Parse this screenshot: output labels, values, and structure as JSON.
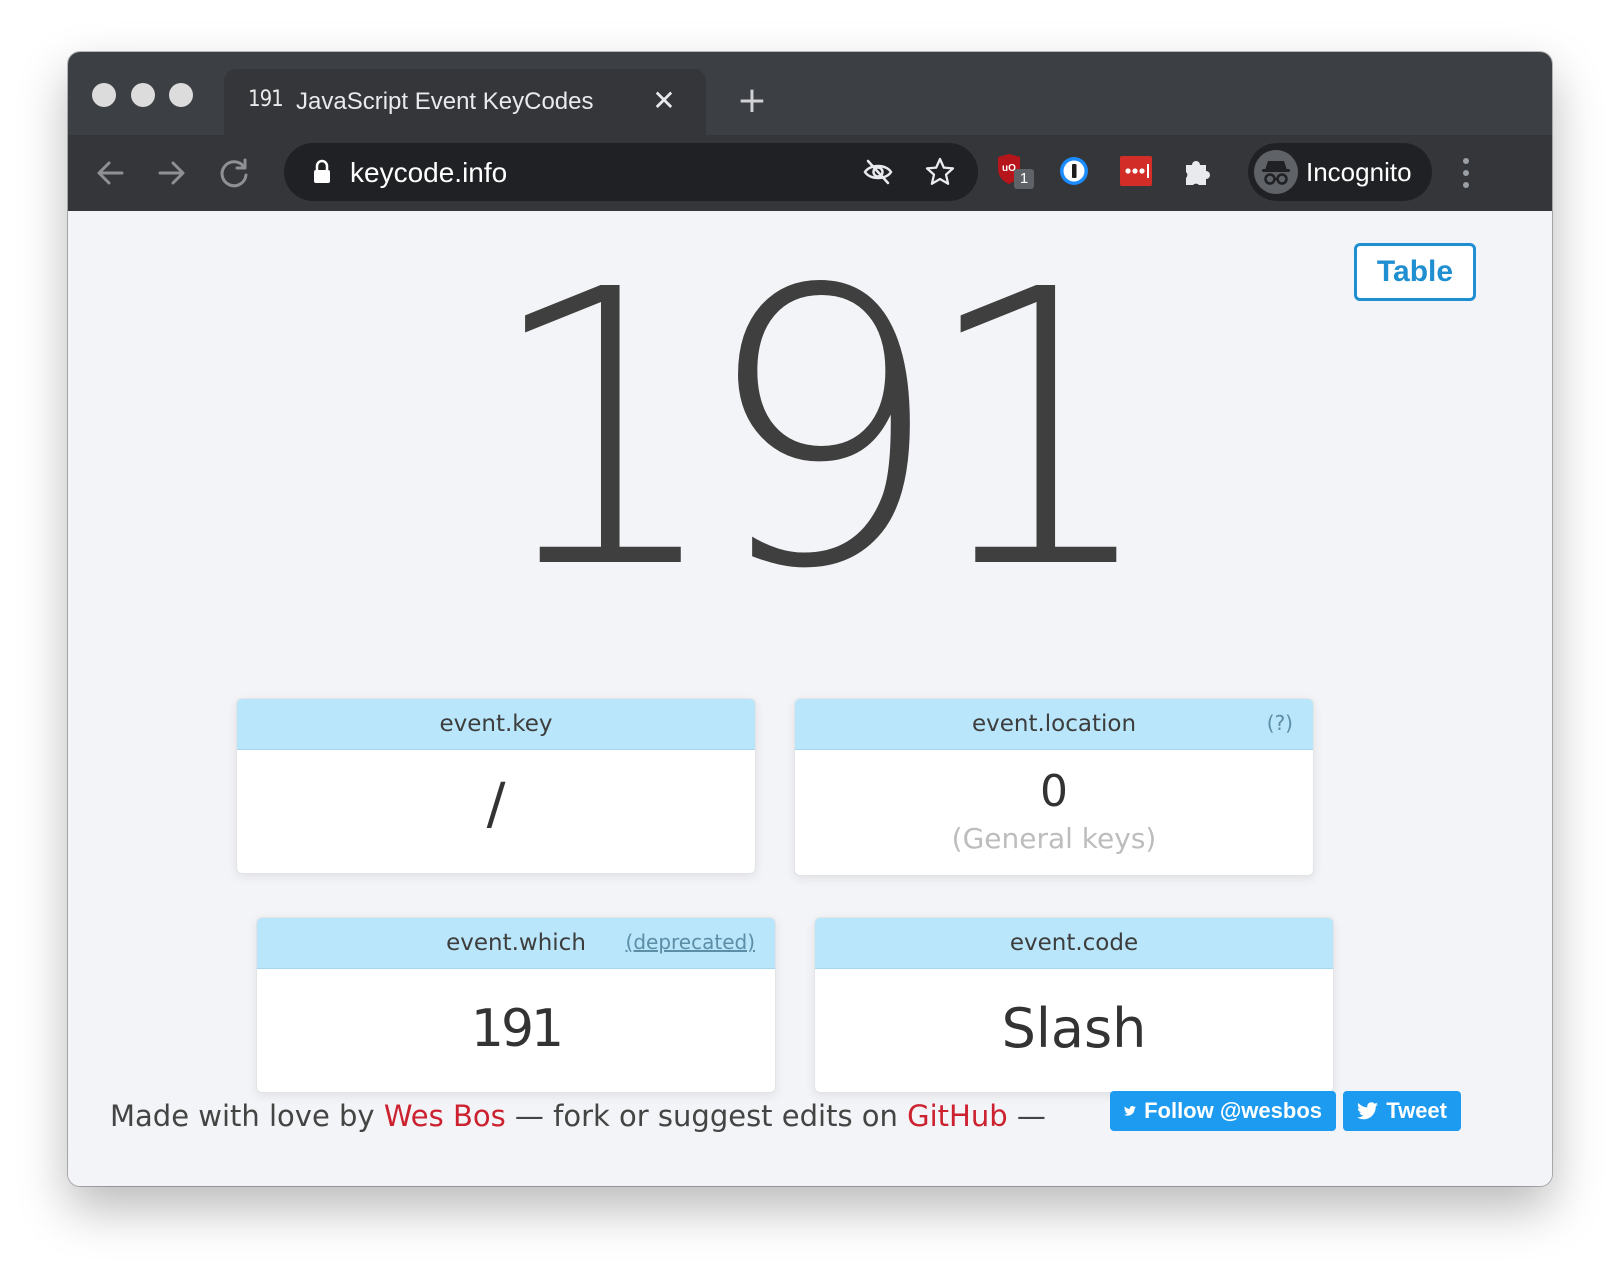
{
  "tab": {
    "favicon_text": "191",
    "title": "JavaScript Event KeyCodes",
    "close_label": "✕",
    "new_tab_label": "+"
  },
  "address_bar": {
    "url": "keycode.info"
  },
  "extensions": {
    "ublock_badge": "1"
  },
  "profile": {
    "label": "Incognito"
  },
  "page": {
    "table_button": "Table",
    "big_keycode": "191",
    "cards": {
      "key": {
        "title": "event.key",
        "value": "/"
      },
      "location": {
        "title": "event.location",
        "note": "(?)",
        "value": "0",
        "sub": "(General keys)"
      },
      "which": {
        "title": "event.which",
        "note": "(deprecated)",
        "value": "191"
      },
      "code": {
        "title": "event.code",
        "value": "Slash"
      }
    },
    "footer": {
      "prefix": "Made with love by ",
      "author": "Wes Bos",
      "middle": " — fork or suggest edits on ",
      "repo": "GitHub",
      "suffix": " —",
      "follow_button": "Follow @wesbos",
      "tweet_button": "Tweet"
    }
  },
  "colors": {
    "accent": "#1f8fd1",
    "card_header": "#b9e6fa",
    "link_red": "#cc2230",
    "twitter": "#1d9bf0"
  }
}
